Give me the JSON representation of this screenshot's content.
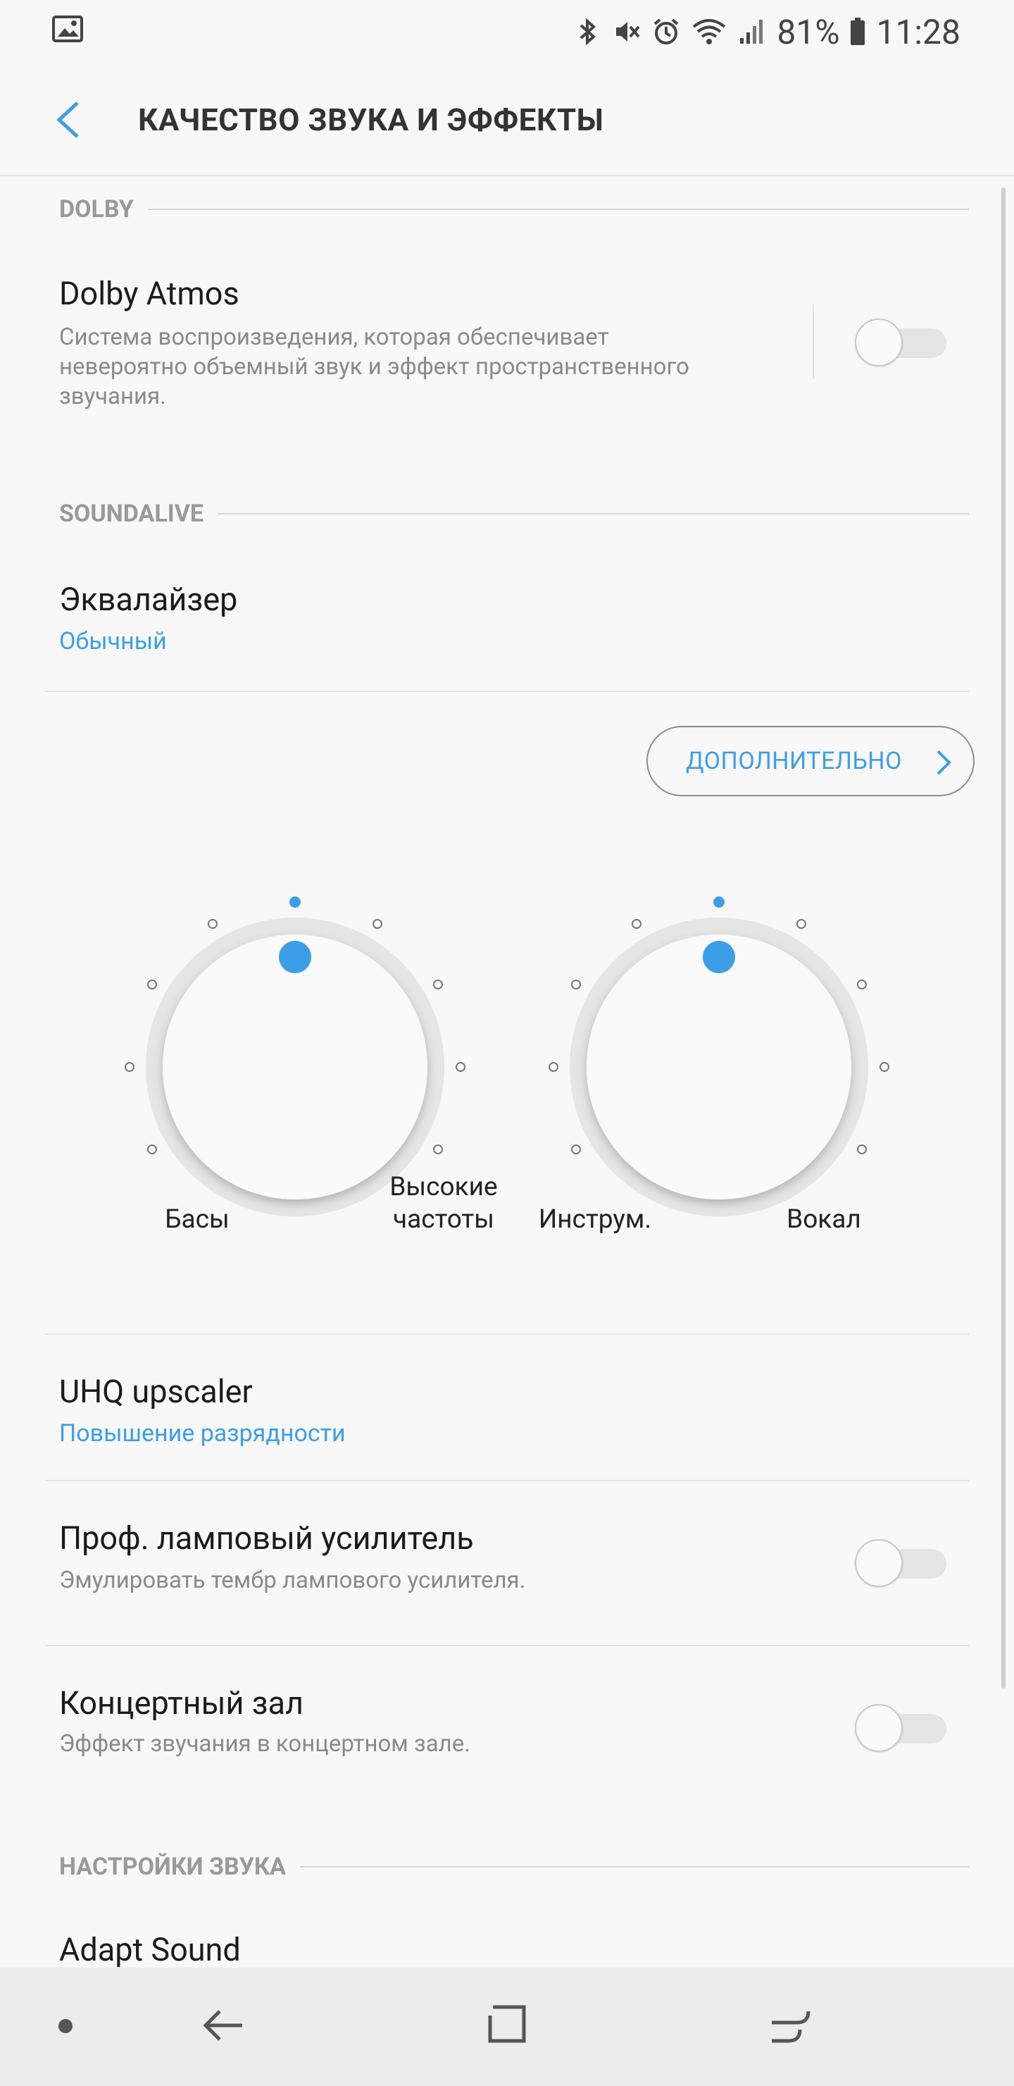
{
  "status_bar": {
    "battery": "81%",
    "time": "11:28",
    "icons": [
      "image-icon",
      "bluetooth-icon",
      "mute-icon",
      "alarm-icon",
      "wifi-icon",
      "signal-icon",
      "battery-icon"
    ]
  },
  "header": {
    "title": "КАЧЕСТВО ЗВУКА И ЭФФЕКТЫ"
  },
  "sections": {
    "dolby": "DOLBY",
    "soundalive": "SOUNDALIVE",
    "sound_settings": "НАСТРОЙКИ ЗВУКА"
  },
  "dolby_atmos": {
    "title": "Dolby Atmos",
    "line1": "Система воспроизведения, которая обеспечивает",
    "line2": "невероятно объемный звук и эффект пространственного",
    "line3": "звучания.",
    "enabled": false
  },
  "equalizer": {
    "title": "Эквалайзер",
    "value": "Обычный"
  },
  "more_button": {
    "label": "ДОПОЛНИТЕЛЬНО"
  },
  "knobs": {
    "bass_treble": {
      "left_label": "Басы",
      "right_label_1": "Высокие",
      "right_label_2": "частоты",
      "level": 0
    },
    "instr_vocal": {
      "left_label": "Инструм.",
      "right_label": "Вокал",
      "level": 0
    }
  },
  "uhq": {
    "title": "UHQ upscaler",
    "value": "Повышение разрядности"
  },
  "tube_amp": {
    "title": "Проф. ламповый усилитель",
    "subtitle": "Эмулировать тембр лампового усилителя.",
    "enabled": false
  },
  "concert_hall": {
    "title": "Концертный зал",
    "subtitle": "Эффект звучания в концертном зале.",
    "enabled": false
  },
  "adapt_sound": {
    "title": "Adapt Sound"
  },
  "colors": {
    "accent": "#3d9ee8",
    "text": "#1b1b1b",
    "secondary": "#8a8a8a",
    "background": "#f8f8f8"
  }
}
